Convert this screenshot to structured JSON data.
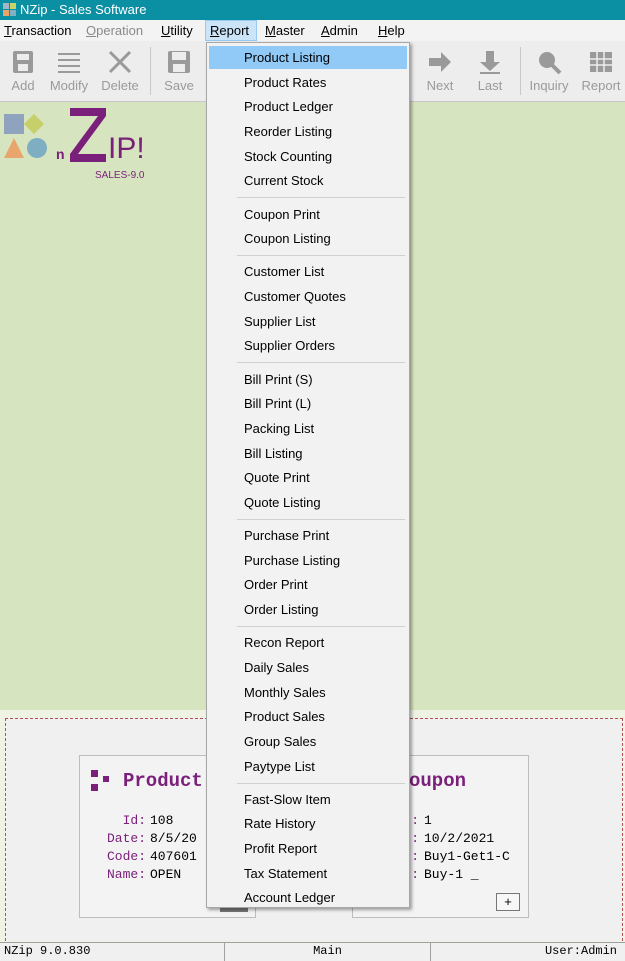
{
  "window": {
    "title": "NZip - Sales Software"
  },
  "menubar": {
    "items": [
      {
        "label": "Transaction",
        "accel": "T"
      },
      {
        "label": "Operation",
        "accel": "O",
        "disabled": true
      },
      {
        "label": "Utility",
        "accel": "U"
      },
      {
        "label": "Report",
        "accel": "R",
        "active": true
      },
      {
        "label": "Master",
        "accel": "M"
      },
      {
        "label": "Admin",
        "accel": "A"
      },
      {
        "label": "Help",
        "accel": "H"
      }
    ]
  },
  "toolbar": {
    "add": "Add",
    "modify": "Modify",
    "delete": "Delete",
    "save": "Save",
    "next": "Next",
    "last": "Last",
    "inquiry": "Inquiry",
    "report": "Report"
  },
  "logo": {
    "letters_ip": "IP!",
    "letter_n": "n",
    "sales": "SALES-9.0"
  },
  "report_menu": {
    "groups": [
      [
        "Product Listing",
        "Product Rates",
        "Product Ledger",
        "Reorder Listing",
        "Stock Counting",
        "Current Stock"
      ],
      [
        "Coupon Print",
        "Coupon Listing"
      ],
      [
        "Customer List",
        "Customer Quotes",
        "Supplier List",
        "Supplier Orders"
      ],
      [
        "Bill Print (S)",
        "Bill Print (L)",
        "Packing List",
        "Bill Listing",
        "Quote Print",
        "Quote Listing"
      ],
      [
        "Purchase Print",
        "Purchase Listing",
        "Order Print",
        "Order Listing"
      ],
      [
        "Recon Report",
        "Daily Sales",
        "Monthly Sales",
        "Product Sales",
        "Group Sales",
        "Paytype List"
      ],
      [
        "Fast-Slow Item",
        "Rate History",
        "Profit Report",
        "Tax Statement",
        "Account Ledger"
      ]
    ],
    "highlighted": "Product Listing"
  },
  "product_panel": {
    "title": "Product",
    "labels": [
      "Id:",
      "Date:",
      "Code:",
      "Name:"
    ],
    "values": [
      "108",
      "8/5/20",
      "407601",
      "OPEN"
    ]
  },
  "coupon_panel": {
    "title": "oupon",
    "labels": [
      ":",
      ":",
      ":",
      ":"
    ],
    "values": [
      "1",
      "10/2/2021",
      "Buy1-Get1-C",
      "Buy-1 _"
    ],
    "plus": "+"
  },
  "statusbar": {
    "version": "NZip 9.0.830",
    "mode": "Main",
    "user": "User:Admin"
  },
  "colors": {
    "titlebar": "#0b8fa3",
    "highlight": "#91c9f7",
    "brand": "#7a1f7a",
    "desktop": "#d7e4c0"
  }
}
